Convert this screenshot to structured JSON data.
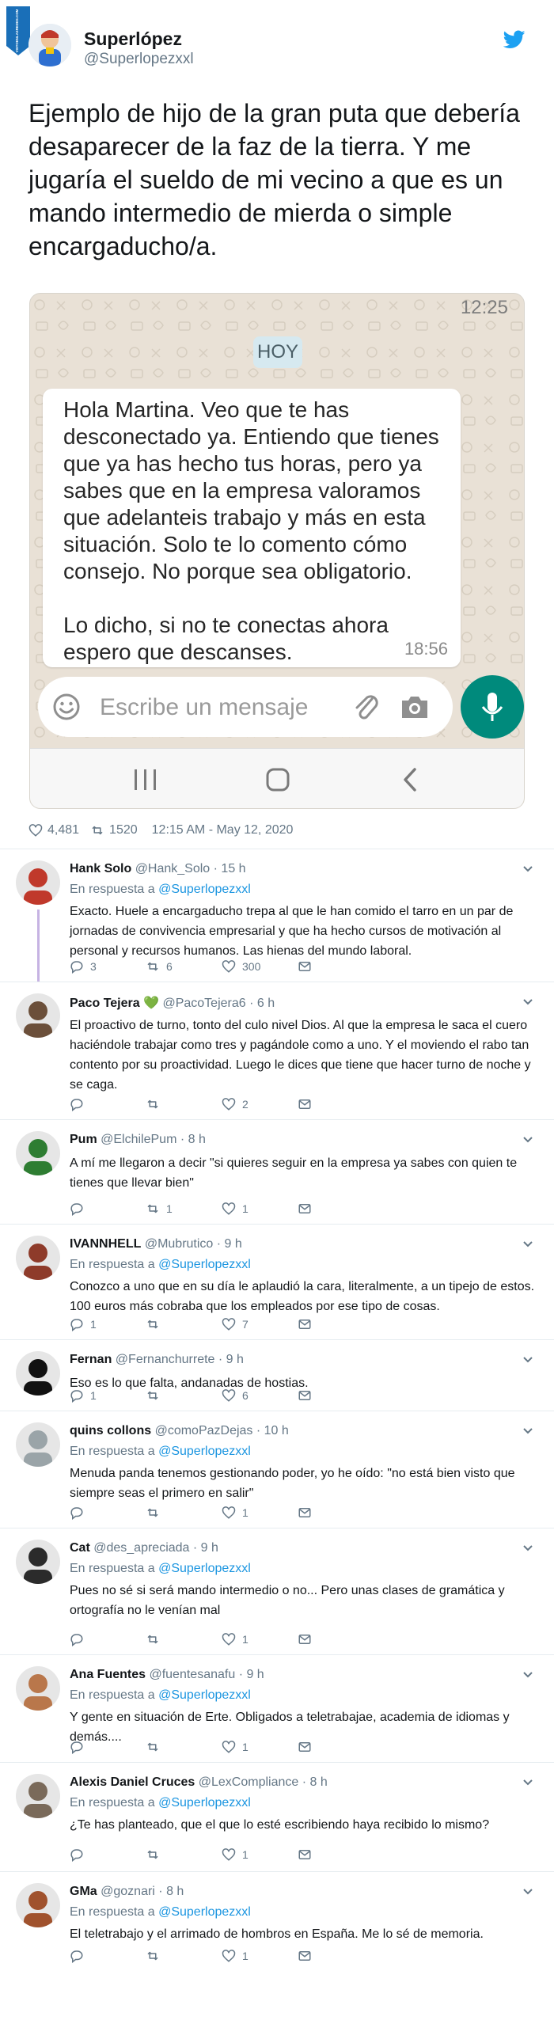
{
  "watermark": "VISTOENLASREDES.COM",
  "tweet": {
    "author_name": "Superlópez",
    "author_handle": "@Superlopezxxl",
    "text": "Ejemplo de hijo de la gran puta que debería desaparecer de la faz de la tierra. Y me jugaría el sueldo de mi vecino a que es un mando intermedio de mierda o simple encargaducho/a.",
    "likes": "4,481",
    "retweets": "1520",
    "timestamp": "12:15 AM - May 12, 2020"
  },
  "whatsapp": {
    "top_time": "12:25",
    "day_label": "HOY",
    "message": "Hola Martina. Veo que te has desconectado ya. Entiendo que tienes que ya has hecho tus horas, pero ya sabes que en la empresa valoramos que adelanteis trabajo y más en esta situación. Solo te lo comento cómo consejo. No porque sea obligatorio.\n\nLo dicho, si no te conectas ahora espero que descanses.",
    "message_time": "18:56",
    "input_placeholder": "Escribe un mensaje"
  },
  "replies": [
    {
      "name": "Hank Solo",
      "handle": "@Hank_Solo",
      "time": "· 15 h",
      "in_reply": true,
      "in_reply_prefix": "En respuesta a",
      "in_reply_to": "@Superlopezxxl",
      "text": "Exacto. Huele a encargaducho trepa al que le han comido el tarro en un par de jornadas de convivencia empresarial y que ha hecho cursos de motivación al personal y recursos humanos. Las hienas del mundo laboral.",
      "replies_count": "3",
      "retweets_count": "6",
      "likes_count": "300",
      "avatar_color": "#c0392b"
    },
    {
      "name": "Paco Tejera 💚",
      "handle": "@PacoTejera6",
      "time": "· 6 h",
      "in_reply": false,
      "text": "El proactivo de turno, tonto del culo nivel Dios. Al que la empresa le saca el cuero haciéndole trabajar como tres y pagándole como a uno. Y el moviendo el rabo tan contento por su proactividad. Luego le dices que tiene que hacer turno de noche y se caga.",
      "replies_count": "",
      "retweets_count": "",
      "likes_count": "2",
      "avatar_color": "#6b4f3a"
    },
    {
      "name": "Pum",
      "handle": "@ElchilePum",
      "time": "· 8 h",
      "in_reply": false,
      "text": "A mí me llegaron a decir \"si quieres seguir en la empresa ya sabes con quien te tienes que llevar bien\"",
      "replies_count": "",
      "retweets_count": "1",
      "likes_count": "1",
      "avatar_color": "#2e7d32"
    },
    {
      "name": "IVANNHELL",
      "handle": "@Mubrutico",
      "time": "· 9 h",
      "in_reply": true,
      "in_reply_prefix": "En respuesta a",
      "in_reply_to": "@Superlopezxxl",
      "text": "Conozco a uno que en su día le aplaudió la cara, literalmente, a un tipejo de estos. 100 euros más cobraba que los empleados por ese tipo de cosas.",
      "replies_count": "1",
      "retweets_count": "",
      "likes_count": "7",
      "avatar_color": "#8e3b2a"
    },
    {
      "name": "Fernan",
      "handle": "@Fernanchurrete",
      "time": "· 9 h",
      "in_reply": false,
      "text": "Eso es lo que falta, andanadas de hostias.",
      "replies_count": "1",
      "retweets_count": "",
      "likes_count": "6",
      "avatar_color": "#111111"
    },
    {
      "name": "quins collons",
      "handle": "@comoPazDejas",
      "time": "· 10 h",
      "in_reply": true,
      "in_reply_prefix": "En respuesta a",
      "in_reply_to": "@Superlopezxxl",
      "text": "Menuda panda tenemos gestionando poder, yo he oído: \"no está bien visto que siempre seas el primero en salir\"",
      "replies_count": "",
      "retweets_count": "",
      "likes_count": "1",
      "avatar_color": "#9aa4a8"
    },
    {
      "name": "Cat",
      "handle": "@des_apreciada",
      "time": "· 9 h",
      "in_reply": true,
      "in_reply_prefix": "En respuesta a",
      "in_reply_to": "@Superlopezxxl",
      "text": "Pues no sé si será mando intermedio o no... Pero unas clases de gramática y ortografía no le venían mal",
      "replies_count": "",
      "retweets_count": "",
      "likes_count": "1",
      "avatar_color": "#2b2b2b"
    },
    {
      "name": "Ana Fuentes",
      "handle": "@fuentesanafu",
      "time": "· 9 h",
      "in_reply": true,
      "in_reply_prefix": "En respuesta a",
      "in_reply_to": "@Superlopezxxl",
      "text": "Y gente en situación de Erte. Obligados a teletrabajae, academia de idiomas y demás....",
      "replies_count": "",
      "retweets_count": "",
      "likes_count": "1",
      "avatar_color": "#b9774b"
    },
    {
      "name": "Alexis Daniel Cruces",
      "handle": "@LexCompliance",
      "time": "· 8 h",
      "in_reply": true,
      "in_reply_prefix": "En respuesta a",
      "in_reply_to": "@Superlopezxxl",
      "text": "¿Te has planteado, que el que lo esté escribiendo haya recibido lo mismo?",
      "replies_count": "",
      "retweets_count": "",
      "likes_count": "1",
      "avatar_color": "#7a6a5a"
    },
    {
      "name": "GMa",
      "handle": "@goznari",
      "time": "· 8 h",
      "in_reply": true,
      "in_reply_prefix": "En respuesta a",
      "in_reply_to": "@Superlopezxxl",
      "text": "El teletrabajo y el arrimado de hombros en España. Me lo sé de memoria.",
      "replies_count": "",
      "retweets_count": "",
      "likes_count": "1",
      "avatar_color": "#a0522d"
    }
  ],
  "colors": {
    "twitter_blue": "#1da1f2",
    "link_blue": "#1b95e0",
    "whatsapp_green": "#008a7c",
    "thread_line": "#c6b3e3"
  }
}
